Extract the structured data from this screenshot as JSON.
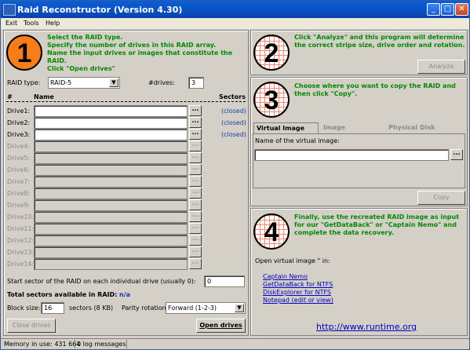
{
  "window": {
    "title": "Raid Reconstructor (Version 4.30)"
  },
  "menu": [
    "Exit",
    "Tools",
    "Help"
  ],
  "step1": {
    "number": "1",
    "instructions": [
      "Select the RAID type.",
      "Specify the number of drives in this RAID array.",
      "Name the input drives or images that constitute the RAID.",
      "Click \"Open drives\""
    ]
  },
  "raid": {
    "type_label": "RAID type:",
    "type_value": "RAID-5",
    "drives_label": "#drives:",
    "drives_value": "3"
  },
  "drives_table": {
    "headers": {
      "num": "#",
      "name": "Name",
      "sectors": "Sectors"
    },
    "rows": [
      {
        "label": "Drive1:",
        "status": "(closed)"
      },
      {
        "label": "Drive2:",
        "status": "(closed)"
      },
      {
        "label": "Drive3:",
        "status": "(closed)"
      },
      {
        "label": "Drive4:",
        "status": ""
      },
      {
        "label": "Drive5:",
        "status": ""
      },
      {
        "label": "Drive6:",
        "status": ""
      },
      {
        "label": "Drive7:",
        "status": ""
      },
      {
        "label": "Drive8:",
        "status": ""
      },
      {
        "label": "Drive9:",
        "status": ""
      },
      {
        "label": "Drive10:",
        "status": ""
      },
      {
        "label": "Drive11:",
        "status": ""
      },
      {
        "label": "Drive12:",
        "status": ""
      },
      {
        "label": "Drive13:",
        "status": ""
      },
      {
        "label": "Drive14:",
        "status": ""
      }
    ],
    "browse_label": "..."
  },
  "start_sector": {
    "label": "Start sector of the RAID on each individual drive (usually 0):",
    "value": "0"
  },
  "total_sectors": {
    "label": "Total sectors available in RAID:",
    "value": "n/a"
  },
  "block": {
    "label": "Block size:",
    "value": "16",
    "unit": "sectors (8 KB)",
    "parity_label": "Parity rotation:",
    "parity_value": "Forward (1-2-3)"
  },
  "buttons": {
    "close_drives": "Close drives",
    "open_drives": "Open drives",
    "analyze": "Analyze",
    "copy": "Copy"
  },
  "step2": {
    "number": "2",
    "text": [
      "Click \"Analyze\" and this program will determine",
      "the correct stripe size, drive order and rotation."
    ]
  },
  "step3": {
    "number": "3",
    "text": [
      "Choose where you want to copy the RAID and",
      "then click \"Copy\"."
    ],
    "tabs": [
      "Virtual Image",
      "Image",
      "Physical Disk"
    ],
    "virtual_label": "Name of the virtual image:"
  },
  "step4": {
    "number": "4",
    "text": [
      "Finally, use the recreated RAID image as input",
      "for our \"GetDataBack\" or \"Captain Nemo\" and",
      "complete the data recovery."
    ],
    "open_label": "Open virtual image \" in:",
    "links": [
      "Captain Nemo",
      "GetDataBack for NTFS",
      "DiskExplorer for NTFS",
      "Notepad (edit or view)"
    ],
    "url": "http://www.runtime.org"
  },
  "status": {
    "memory": "Memory in use: 431 664",
    "log": "0 log messages"
  },
  "colors": {
    "accent_orange": "#f77d1a",
    "green_text": "#008a00",
    "titlebar": "#0b4fc0",
    "link": "#0000c0"
  }
}
